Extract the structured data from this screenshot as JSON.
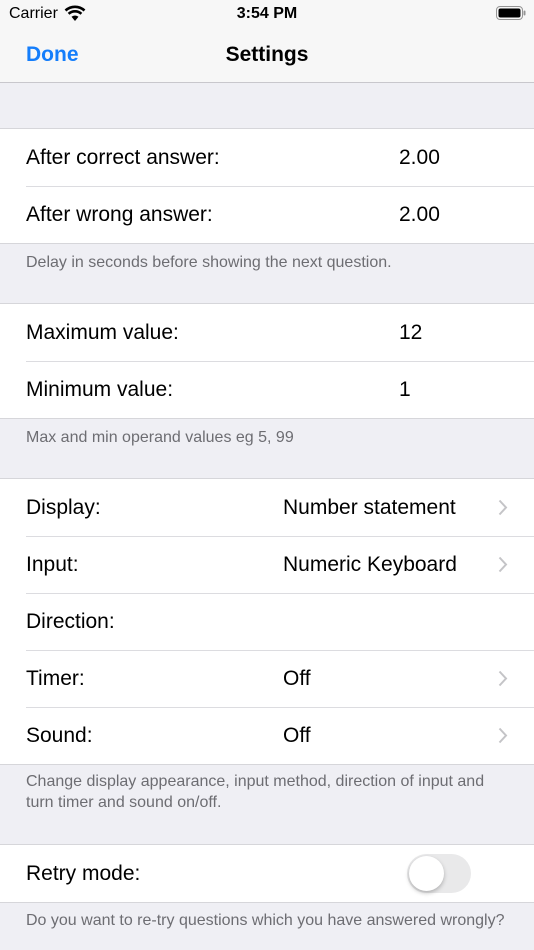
{
  "status_bar": {
    "carrier": "Carrier",
    "time": "3:54 PM"
  },
  "nav": {
    "done_label": "Done",
    "title": "Settings"
  },
  "delay": {
    "rows": [
      {
        "label": "After correct answer:",
        "value": "2.00"
      },
      {
        "label": "After wrong answer:",
        "value": "2.00"
      }
    ],
    "footer": "Delay in seconds before showing the next question."
  },
  "range": {
    "rows": [
      {
        "label": "Maximum value:",
        "value": "12"
      },
      {
        "label": "Minimum value:",
        "value": "1"
      }
    ],
    "footer": "Max and min operand values eg 5, 99"
  },
  "display_settings": {
    "rows": [
      {
        "label": "Display:",
        "value": "Number statement"
      },
      {
        "label": "Input:",
        "value": "Numeric Keyboard"
      },
      {
        "label": "Direction:",
        "value": ""
      },
      {
        "label": "Timer:",
        "value": "Off"
      },
      {
        "label": "Sound:",
        "value": "Off"
      }
    ],
    "footer": "Change display appearance, input method, direction of input and turn timer and sound on/off."
  },
  "retry": {
    "label": "Retry mode:",
    "enabled": false,
    "footer": "Do you want to re-try questions which you have answered wrongly?"
  }
}
